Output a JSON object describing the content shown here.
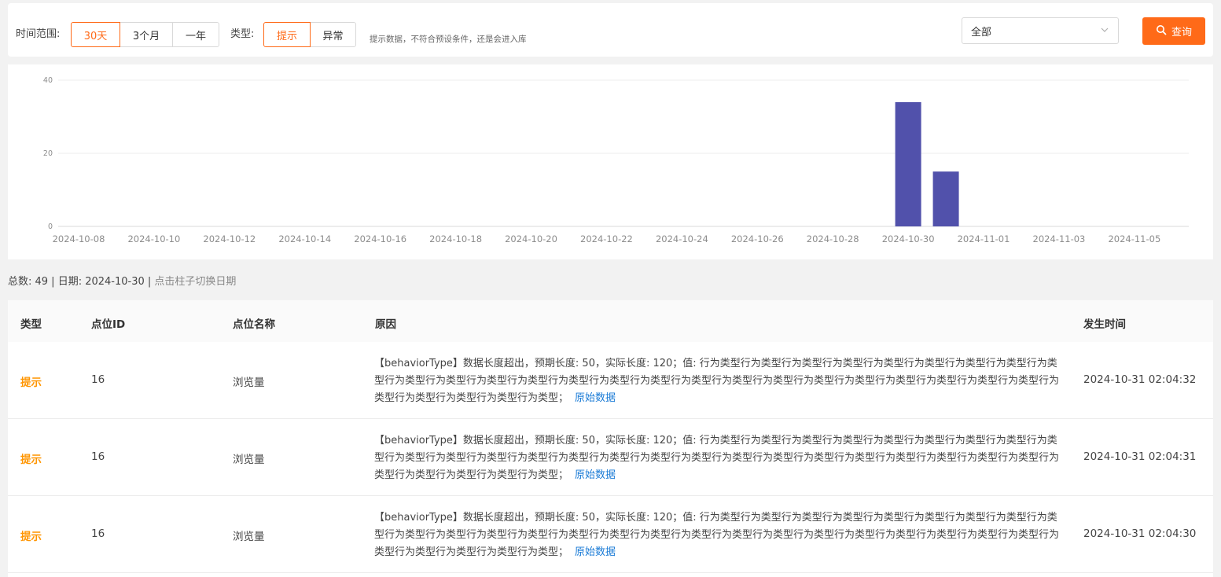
{
  "filters": {
    "time_label": "时间范围:",
    "time_options": [
      "30天",
      "3个月",
      "一年"
    ],
    "type_label": "类型:",
    "type_options": [
      "提示",
      "异常"
    ],
    "hint": "提示数据，不符合预设条件，还是会进入库",
    "select_value": "全部",
    "search_label": "查询"
  },
  "colors": {
    "accent": "#ff6a18",
    "bar": "#5151ab",
    "link": "#1a7bd6",
    "warn": "#ff9500"
  },
  "chart_data": {
    "type": "bar",
    "categories": [
      "2024-10-08",
      "2024-10-09",
      "2024-10-10",
      "2024-10-11",
      "2024-10-12",
      "2024-10-13",
      "2024-10-14",
      "2024-10-15",
      "2024-10-16",
      "2024-10-17",
      "2024-10-18",
      "2024-10-19",
      "2024-10-20",
      "2024-10-21",
      "2024-10-22",
      "2024-10-23",
      "2024-10-24",
      "2024-10-25",
      "2024-10-26",
      "2024-10-27",
      "2024-10-28",
      "2024-10-29",
      "2024-10-30",
      "2024-10-31",
      "2024-11-01",
      "2024-11-02",
      "2024-11-03",
      "2024-11-04",
      "2024-11-05",
      "2024-11-06"
    ],
    "values": [
      0,
      0,
      0,
      0,
      0,
      0,
      0,
      0,
      0,
      0,
      0,
      0,
      0,
      0,
      0,
      0,
      0,
      0,
      0,
      0,
      0,
      0,
      34,
      15,
      0,
      0,
      0,
      0,
      0,
      0
    ],
    "tick_labels": [
      "2024-10-08",
      "2024-10-10",
      "2024-10-12",
      "2024-10-14",
      "2024-10-16",
      "2024-10-18",
      "2024-10-20",
      "2024-10-22",
      "2024-10-24",
      "2024-10-26",
      "2024-10-28",
      "2024-10-30",
      "2024-11-01",
      "2024-11-03",
      "2024-11-05"
    ],
    "yticks": [
      0,
      20,
      40
    ],
    "ylim": [
      0,
      40
    ],
    "grid": true
  },
  "summary": {
    "text": "总数: 49 | 日期: 2024-10-30 |",
    "tip": "点击柱子切换日期"
  },
  "table": {
    "headers": [
      "类型",
      "点位ID",
      "点位名称",
      "原因",
      "发生时间"
    ],
    "link_label": "原始数据",
    "rows": [
      {
        "type": "提示",
        "id": "16",
        "name": "浏览量",
        "reason": "【behaviorType】数据长度超出，预期长度: 50，实际长度: 120；值: 行为类型行为类型行为类型行为类型行为类型行为类型行为类型行为类型行为类型行为类型行为类型行为类型行为类型行为类型行为类型行为类型行为类型行为类型行为类型行为类型行为类型行为类型行为类型行为类型行为类型行为类型行为类型行为类型行为类型行为类型；",
        "time": "2024-10-31 02:04:32"
      },
      {
        "type": "提示",
        "id": "16",
        "name": "浏览量",
        "reason": "【behaviorType】数据长度超出，预期长度: 50，实际长度: 120；值: 行为类型行为类型行为类型行为类型行为类型行为类型行为类型行为类型行为类型行为类型行为类型行为类型行为类型行为类型行为类型行为类型行为类型行为类型行为类型行为类型行为类型行为类型行为类型行为类型行为类型行为类型行为类型行为类型行为类型行为类型；",
        "time": "2024-10-31 02:04:31"
      },
      {
        "type": "提示",
        "id": "16",
        "name": "浏览量",
        "reason": "【behaviorType】数据长度超出，预期长度: 50，实际长度: 120；值: 行为类型行为类型行为类型行为类型行为类型行为类型行为类型行为类型行为类型行为类型行为类型行为类型行为类型行为类型行为类型行为类型行为类型行为类型行为类型行为类型行为类型行为类型行为类型行为类型行为类型行为类型行为类型行为类型行为类型行为类型；",
        "time": "2024-10-31 02:04:30"
      }
    ]
  }
}
